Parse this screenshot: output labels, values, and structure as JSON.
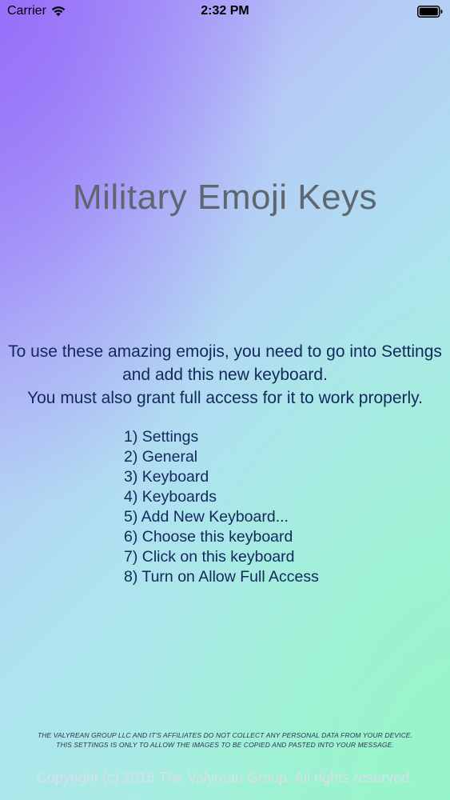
{
  "status_bar": {
    "carrier": "Carrier",
    "time": "2:32 PM"
  },
  "title": "Military Emoji Keys",
  "instructions": [
    "To use these amazing emojis, you need to go into Settings",
    "and add this new keyboard.",
    "You must also grant full access for it to work properly."
  ],
  "steps": [
    "1) Settings",
    "2) General",
    "3) Keyboard",
    "4) Keyboards",
    "5) Add New Keyboard...",
    "6) Choose this keyboard",
    "7) Click on this keyboard",
    "8) Turn on Allow Full Access"
  ],
  "disclaimer": [
    "THE VALYREAN GROUP LLC AND IT'S AFFILIATES DO NOT COLLECT ANY PERSONAL DATA FROM YOUR DEVICE.",
    "THIS SETTINGS IS ONLY TO ALLOW THE IMAGES TO BE COPIED AND PASTED INTO YOUR MESSAGE."
  ],
  "copyright": "Copyright (c) 2016 The Valyrean Group. All rights reserved.",
  "icons": {
    "wifi": "wifi-icon",
    "battery": "battery-icon"
  },
  "colors": {
    "title": "#5e6670",
    "text": "#13285c",
    "copyright": "#d9dfe6"
  }
}
